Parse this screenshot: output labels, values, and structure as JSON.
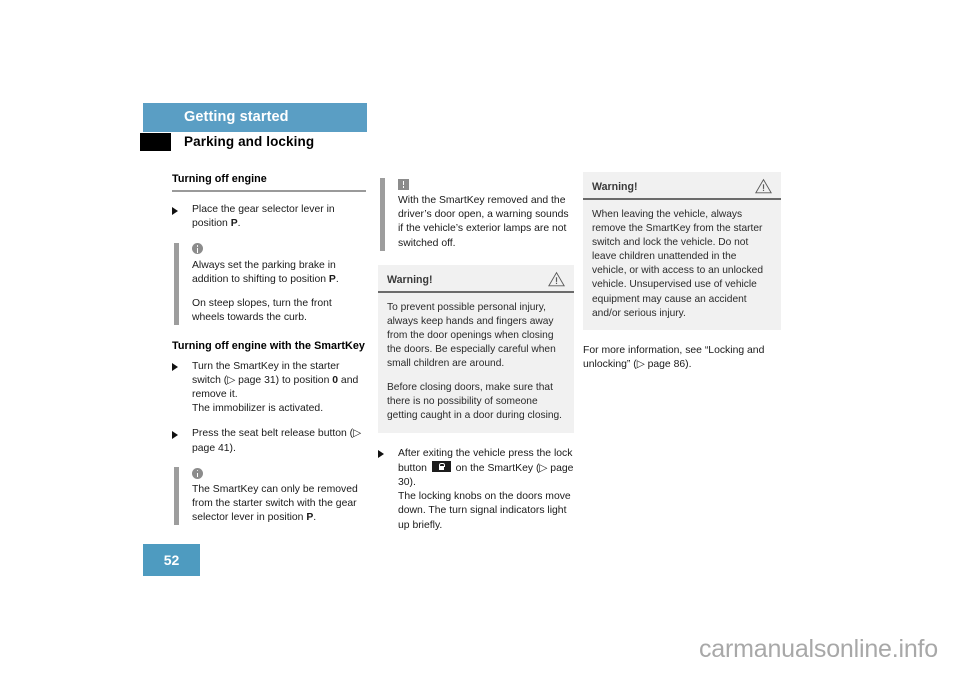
{
  "colors": {
    "chapter_bar": "#5a9ec4",
    "page_number_box": "#4e9bc0",
    "note_bar_gray": "#9d9d9d",
    "warning_box_bg": "#f1f1f1",
    "section_marker": "#000000",
    "watermark": "#a8a8a8"
  },
  "header": {
    "chapter": "Getting started",
    "section": "Parking and locking"
  },
  "column1": {
    "heading1": "Turning off engine",
    "bullet1": "Place the gear selector lever in position ",
    "bullet1_bold": "P",
    "bullet1_end": ".",
    "note1": {
      "icon": "info-icon",
      "paragraph1_a": "Always set the parking brake in addition to shifting to position ",
      "paragraph1_bold": "P",
      "paragraph1_b": ".",
      "paragraph2": "On steep slopes, turn the front wheels towards the curb."
    },
    "heading2": "Turning off engine with the SmartKey",
    "bullet2_a": "Turn the SmartKey in the starter switch (▷ page 31) to position ",
    "bullet2_bold": "0",
    "bullet2_b": " and remove it.",
    "bullet2_sub": "The immobilizer is activated.",
    "bullet3": "Press the seat belt release button (▷ page 41).",
    "note2": {
      "icon": "info-icon",
      "paragraph1_a": "The SmartKey can only be removed from the starter switch with the gear selector lever in position ",
      "paragraph1_bold": "P",
      "paragraph1_b": "."
    }
  },
  "column2": {
    "note1": {
      "icon": "exclamation-square-icon",
      "paragraph1": "With the SmartKey removed and the driver’s door open, a warning sounds if the vehicle’s exterior lamps are not switched off."
    },
    "warning": {
      "title": "Warning!",
      "icon": "warning-triangle-icon",
      "paragraph1": "To prevent possible personal injury, always keep hands and fingers away from the door openings when closing the doors. Be especially careful when small children are around.",
      "paragraph2": "Before closing doors, make sure that there is no possibility of someone getting caught in a door during closing."
    },
    "bullet1_a": "After exiting the vehicle press the lock button ",
    "bullet1_icon": "lock-button-icon",
    "bullet1_b": " on the SmartKey (▷ page 30).",
    "bullet1_sub": "The locking knobs on the doors move down. The turn signal indicators light up briefly."
  },
  "column3": {
    "warning": {
      "title": "Warning!",
      "icon": "warning-triangle-icon",
      "paragraph1": "When leaving the vehicle, always remove the SmartKey from the starter switch and lock the vehicle. Do not leave children unattended in the vehicle, or with access to an unlocked vehicle. Unsupervised use of vehicle equipment may cause an accident and/or serious injury."
    },
    "cross_reference": "For more information, see “Locking and unlocking” (▷ page 86)."
  },
  "footer": {
    "page_number": "52",
    "watermark": "carmanualsonline.info"
  }
}
